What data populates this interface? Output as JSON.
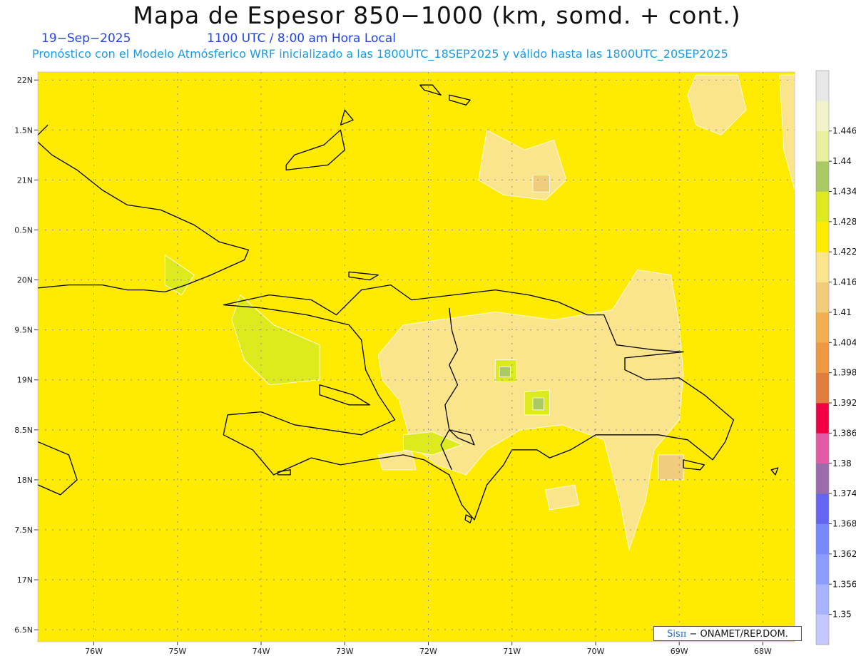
{
  "header": {
    "title": "Mapa de Espesor 850−1000 (km, somd. + cont.)",
    "date": "19−Sep−2025",
    "time": "1100 UTC / 8:00 am Hora Local",
    "forecast_note": "Pronóstico con el Modelo Atmósferico WRF inicializado a las 1800UTC_18SEP2025 y válido hasta las  1800UTC_20SEP2025"
  },
  "colors": {
    "base_field": "#ffeb00",
    "band_1410": "#fbe58c",
    "band_1404": "#f1cc7c",
    "band_1422": "#dcea1e",
    "band_1428": "#a8c964",
    "coast": "#000000",
    "grid": "#8a8aa8"
  },
  "map": {
    "lon_range": [
      -76.67,
      -67.62
    ],
    "lat_range": [
      16.38,
      22.08
    ],
    "lat_labels": [
      {
        "lat": 22.0,
        "text": "22N"
      },
      {
        "lat": 21.5,
        "text": "1.5N"
      },
      {
        "lat": 21.0,
        "text": "21N"
      },
      {
        "lat": 20.5,
        "text": "0.5N"
      },
      {
        "lat": 20.0,
        "text": "20N"
      },
      {
        "lat": 19.5,
        "text": "9.5N"
      },
      {
        "lat": 19.0,
        "text": "19N"
      },
      {
        "lat": 18.5,
        "text": "8.5N"
      },
      {
        "lat": 18.0,
        "text": "18N"
      },
      {
        "lat": 17.5,
        "text": "7.5N"
      },
      {
        "lat": 17.0,
        "text": "17N"
      },
      {
        "lat": 16.5,
        "text": "6.5N"
      }
    ],
    "lon_labels": [
      {
        "lon": -76,
        "text": "76W"
      },
      {
        "lon": -75,
        "text": "75W"
      },
      {
        "lon": -74,
        "text": "74W"
      },
      {
        "lon": -73,
        "text": "73W"
      },
      {
        "lon": -72,
        "text": "72W"
      },
      {
        "lon": -71,
        "text": "71W"
      },
      {
        "lon": -70,
        "text": "70W"
      },
      {
        "lon": -69,
        "text": "69W"
      },
      {
        "lon": -68,
        "text": "68W"
      }
    ],
    "blobs": [
      {
        "level": "1.41",
        "color": "#fbe58c",
        "pts": [
          [
            -72.3,
            19.55
          ],
          [
            -71.7,
            19.62
          ],
          [
            -71.2,
            19.68
          ],
          [
            -70.5,
            19.6
          ],
          [
            -69.8,
            19.7
          ],
          [
            -69.5,
            20.1
          ],
          [
            -69.1,
            20.05
          ],
          [
            -69.0,
            19.55
          ],
          [
            -68.95,
            19.05
          ],
          [
            -69.0,
            18.6
          ],
          [
            -69.3,
            18.3
          ],
          [
            -69.4,
            17.8
          ],
          [
            -69.6,
            17.3
          ],
          [
            -69.7,
            17.75
          ],
          [
            -69.9,
            18.4
          ],
          [
            -70.4,
            18.55
          ],
          [
            -70.9,
            18.5
          ],
          [
            -71.3,
            18.3
          ],
          [
            -71.55,
            18.05
          ],
          [
            -71.9,
            18.15
          ],
          [
            -72.2,
            18.35
          ],
          [
            -72.35,
            18.8
          ],
          [
            -72.55,
            19.0
          ],
          [
            -72.6,
            19.25
          ]
        ]
      },
      {
        "level": "1.41",
        "color": "#fbe58c",
        "pts": [
          [
            -71.3,
            21.5
          ],
          [
            -70.85,
            21.3
          ],
          [
            -70.5,
            21.4
          ],
          [
            -70.35,
            21.0
          ],
          [
            -70.6,
            20.8
          ],
          [
            -71.1,
            20.85
          ],
          [
            -71.4,
            21.0
          ]
        ]
      },
      {
        "level": "1.41",
        "color": "#fbe58c",
        "pts": [
          [
            -68.8,
            22.05
          ],
          [
            -68.3,
            22.05
          ],
          [
            -68.2,
            21.7
          ],
          [
            -68.5,
            21.45
          ],
          [
            -68.8,
            21.55
          ],
          [
            -68.9,
            21.85
          ]
        ]
      },
      {
        "level": "1.41",
        "color": "#fbe58c",
        "pts": [
          [
            -67.8,
            22.05
          ],
          [
            -67.62,
            22.05
          ],
          [
            -67.62,
            20.9
          ],
          [
            -67.75,
            21.3
          ]
        ]
      },
      {
        "level": "1.41",
        "color": "#fbe58c",
        "pts": [
          [
            -70.6,
            17.9
          ],
          [
            -70.25,
            17.95
          ],
          [
            -70.2,
            17.75
          ],
          [
            -70.55,
            17.7
          ]
        ]
      },
      {
        "level": "1.41",
        "color": "#fbe58c",
        "pts": [
          [
            -72.6,
            18.25
          ],
          [
            -72.2,
            18.3
          ],
          [
            -72.15,
            18.1
          ],
          [
            -72.55,
            18.1
          ]
        ]
      },
      {
        "level": "1.404",
        "color": "#f1cc7c",
        "pts": [
          [
            -69.25,
            18.25
          ],
          [
            -68.95,
            18.25
          ],
          [
            -68.95,
            18.0
          ],
          [
            -69.25,
            18.0
          ]
        ]
      },
      {
        "level": "1.404",
        "color": "#f1cc7c",
        "pts": [
          [
            -70.75,
            21.05
          ],
          [
            -70.55,
            21.05
          ],
          [
            -70.55,
            20.88
          ],
          [
            -70.75,
            20.88
          ]
        ]
      },
      {
        "level": "1.422",
        "color": "#dcea1e",
        "pts": [
          [
            -74.25,
            19.85
          ],
          [
            -73.85,
            19.55
          ],
          [
            -73.3,
            19.35
          ],
          [
            -73.3,
            19.0
          ],
          [
            -73.9,
            18.95
          ],
          [
            -74.2,
            19.2
          ],
          [
            -74.35,
            19.6
          ]
        ]
      },
      {
        "level": "1.422",
        "color": "#dcea1e",
        "pts": [
          [
            -75.15,
            20.25
          ],
          [
            -74.8,
            20.05
          ],
          [
            -74.95,
            19.85
          ],
          [
            -75.15,
            19.95
          ]
        ]
      },
      {
        "level": "1.422",
        "color": "#dcea1e",
        "pts": [
          [
            -71.2,
            19.2
          ],
          [
            -70.95,
            19.2
          ],
          [
            -70.95,
            18.98
          ],
          [
            -71.2,
            18.98
          ]
        ]
      },
      {
        "level": "1.422",
        "color": "#dcea1e",
        "pts": [
          [
            -70.85,
            18.88
          ],
          [
            -70.55,
            18.9
          ],
          [
            -70.55,
            18.65
          ],
          [
            -70.85,
            18.65
          ]
        ]
      },
      {
        "level": "1.422",
        "color": "#dcea1e",
        "pts": [
          [
            -72.3,
            18.45
          ],
          [
            -71.95,
            18.48
          ],
          [
            -71.6,
            18.35
          ],
          [
            -71.95,
            18.25
          ],
          [
            -72.3,
            18.3
          ]
        ]
      },
      {
        "level": "1.428",
        "color": "#a8c964",
        "pts": [
          [
            -71.15,
            19.13
          ],
          [
            -71.02,
            19.13
          ],
          [
            -71.02,
            19.03
          ],
          [
            -71.15,
            19.03
          ]
        ]
      },
      {
        "level": "1.428",
        "color": "#a8c964",
        "pts": [
          [
            -70.75,
            18.82
          ],
          [
            -70.62,
            18.82
          ],
          [
            -70.62,
            18.7
          ],
          [
            -70.75,
            18.7
          ]
        ]
      }
    ],
    "coast": [
      {
        "name": "hispaniola",
        "closed": true,
        "pts": [
          [
            -74.45,
            19.75
          ],
          [
            -73.9,
            19.85
          ],
          [
            -73.4,
            19.8
          ],
          [
            -73.1,
            19.65
          ],
          [
            -72.8,
            19.9
          ],
          [
            -72.45,
            19.95
          ],
          [
            -72.2,
            19.8
          ],
          [
            -71.7,
            19.85
          ],
          [
            -71.2,
            19.9
          ],
          [
            -70.8,
            19.85
          ],
          [
            -70.45,
            19.78
          ],
          [
            -70.1,
            19.65
          ],
          [
            -69.9,
            19.65
          ],
          [
            -69.75,
            19.35
          ],
          [
            -69.3,
            19.3
          ],
          [
            -68.95,
            19.28
          ],
          [
            -69.65,
            19.22
          ],
          [
            -69.65,
            19.1
          ],
          [
            -69.4,
            19.0
          ],
          [
            -69.0,
            19.02
          ],
          [
            -68.7,
            18.85
          ],
          [
            -68.35,
            18.6
          ],
          [
            -68.45,
            18.38
          ],
          [
            -68.6,
            18.2
          ],
          [
            -68.9,
            18.4
          ],
          [
            -69.25,
            18.45
          ],
          [
            -69.6,
            18.45
          ],
          [
            -70.0,
            18.45
          ],
          [
            -70.3,
            18.3
          ],
          [
            -70.55,
            18.22
          ],
          [
            -70.7,
            18.3
          ],
          [
            -71.0,
            18.3
          ],
          [
            -71.1,
            18.15
          ],
          [
            -71.3,
            17.95
          ],
          [
            -71.45,
            17.6
          ],
          [
            -71.6,
            17.75
          ],
          [
            -71.75,
            18.05
          ],
          [
            -72.05,
            18.2
          ],
          [
            -72.3,
            18.25
          ],
          [
            -72.7,
            18.2
          ],
          [
            -73.05,
            18.15
          ],
          [
            -73.4,
            18.22
          ],
          [
            -73.85,
            18.05
          ],
          [
            -74.1,
            18.3
          ],
          [
            -74.45,
            18.45
          ],
          [
            -74.4,
            18.65
          ],
          [
            -74.0,
            18.68
          ],
          [
            -73.6,
            18.55
          ],
          [
            -73.2,
            18.5
          ],
          [
            -72.8,
            18.45
          ],
          [
            -72.4,
            18.6
          ],
          [
            -72.6,
            18.85
          ],
          [
            -72.75,
            19.1
          ],
          [
            -72.8,
            19.4
          ],
          [
            -72.95,
            19.55
          ],
          [
            -73.2,
            19.6
          ],
          [
            -73.45,
            19.65
          ],
          [
            -74.0,
            19.72
          ]
        ]
      },
      {
        "name": "haiti-dr-border",
        "closed": false,
        "pts": [
          [
            -71.75,
            19.72
          ],
          [
            -71.72,
            19.5
          ],
          [
            -71.65,
            19.3
          ],
          [
            -71.75,
            19.15
          ],
          [
            -71.65,
            18.95
          ],
          [
            -71.8,
            18.75
          ],
          [
            -71.75,
            18.5
          ],
          [
            -71.85,
            18.35
          ],
          [
            -71.72,
            18.1
          ]
        ]
      },
      {
        "name": "tortuga",
        "closed": true,
        "pts": [
          [
            -72.95,
            20.08
          ],
          [
            -72.6,
            20.05
          ],
          [
            -72.7,
            20.0
          ],
          [
            -72.95,
            20.03
          ]
        ]
      },
      {
        "name": "gonave",
        "closed": true,
        "pts": [
          [
            -73.3,
            18.95
          ],
          [
            -72.9,
            18.85
          ],
          [
            -72.7,
            18.75
          ],
          [
            -72.95,
            18.75
          ],
          [
            -73.3,
            18.85
          ]
        ]
      },
      {
        "name": "ile-a-vache",
        "closed": true,
        "pts": [
          [
            -73.8,
            18.08
          ],
          [
            -73.65,
            18.1
          ],
          [
            -73.65,
            18.05
          ],
          [
            -73.8,
            18.05
          ]
        ]
      },
      {
        "name": "enriquillo-lake",
        "closed": true,
        "pts": [
          [
            -71.75,
            18.5
          ],
          [
            -71.5,
            18.45
          ],
          [
            -71.45,
            18.35
          ],
          [
            -71.65,
            18.42
          ]
        ]
      },
      {
        "name": "beata",
        "closed": true,
        "pts": [
          [
            -71.55,
            17.65
          ],
          [
            -71.48,
            17.62
          ],
          [
            -71.5,
            17.57
          ],
          [
            -71.56,
            17.6
          ]
        ]
      },
      {
        "name": "saona",
        "closed": true,
        "pts": [
          [
            -68.95,
            18.2
          ],
          [
            -68.7,
            18.15
          ],
          [
            -68.75,
            18.1
          ],
          [
            -68.95,
            18.12
          ]
        ]
      },
      {
        "name": "cuba-east",
        "closed": false,
        "pts": [
          [
            -76.67,
            19.92
          ],
          [
            -76.3,
            19.95
          ],
          [
            -75.9,
            19.95
          ],
          [
            -75.6,
            19.9
          ],
          [
            -75.4,
            19.9
          ],
          [
            -75.15,
            19.88
          ],
          [
            -74.9,
            19.95
          ],
          [
            -74.6,
            20.05
          ],
          [
            -74.2,
            20.2
          ],
          [
            -74.15,
            20.3
          ],
          [
            -74.5,
            20.38
          ],
          [
            -74.8,
            20.55
          ],
          [
            -75.2,
            20.7
          ],
          [
            -75.6,
            20.75
          ],
          [
            -75.9,
            20.9
          ],
          [
            -76.2,
            21.1
          ],
          [
            -76.5,
            21.25
          ],
          [
            -76.67,
            21.38
          ]
        ]
      },
      {
        "name": "cuba-north-tip",
        "closed": false,
        "pts": [
          [
            -76.67,
            21.45
          ],
          [
            -76.55,
            21.55
          ]
        ]
      },
      {
        "name": "jamaica",
        "closed": false,
        "pts": [
          [
            -76.67,
            18.38
          ],
          [
            -76.3,
            18.25
          ],
          [
            -76.2,
            18.0
          ],
          [
            -76.4,
            17.85
          ],
          [
            -76.67,
            17.95
          ]
        ]
      },
      {
        "name": "great-inagua",
        "closed": true,
        "pts": [
          [
            -73.7,
            21.1
          ],
          [
            -73.2,
            21.15
          ],
          [
            -73.0,
            21.3
          ],
          [
            -73.05,
            21.5
          ],
          [
            -73.25,
            21.35
          ],
          [
            -73.6,
            21.25
          ],
          [
            -73.7,
            21.15
          ]
        ]
      },
      {
        "name": "little-inagua",
        "closed": true,
        "pts": [
          [
            -73.05,
            21.55
          ],
          [
            -72.9,
            21.6
          ],
          [
            -73.0,
            21.7
          ]
        ]
      },
      {
        "name": "caicos-1",
        "closed": true,
        "pts": [
          [
            -72.1,
            21.95
          ],
          [
            -71.95,
            21.95
          ],
          [
            -71.85,
            21.85
          ],
          [
            -72.05,
            21.9
          ]
        ]
      },
      {
        "name": "caicos-2",
        "closed": true,
        "pts": [
          [
            -71.75,
            21.85
          ],
          [
            -71.5,
            21.8
          ],
          [
            -71.55,
            21.75
          ],
          [
            -71.75,
            21.8
          ]
        ]
      },
      {
        "name": "mona-like",
        "closed": true,
        "pts": [
          [
            -67.9,
            18.1
          ],
          [
            -67.82,
            18.12
          ],
          [
            -67.85,
            18.05
          ]
        ]
      }
    ],
    "colorbar": {
      "colors": [
        "#c4c8ff",
        "#a8b4ff",
        "#8c9cff",
        "#7888ff",
        "#6466f0",
        "#9a6caa",
        "#e45aa6",
        "#f00040",
        "#e07c3c",
        "#ee9844",
        "#f2ae50",
        "#f1cc7c",
        "#fbe58c",
        "#ffeb00",
        "#dcea1e",
        "#a8c964",
        "#e6f09e",
        "#f0f4c8",
        "#e8e8e8"
      ],
      "labels": [
        "1.35",
        "1.356",
        "1.362",
        "1.368",
        "1.374",
        "1.38",
        "1.386",
        "1.392",
        "1.398",
        "1.404",
        "1.41",
        "1.416",
        "1.422",
        "1.428",
        "1.434",
        "1.44",
        "1.446"
      ]
    }
  },
  "credit": {
    "prefix": "Sis",
    "pi": "π",
    "suffix": "− ONAMET/REP.DOM."
  }
}
